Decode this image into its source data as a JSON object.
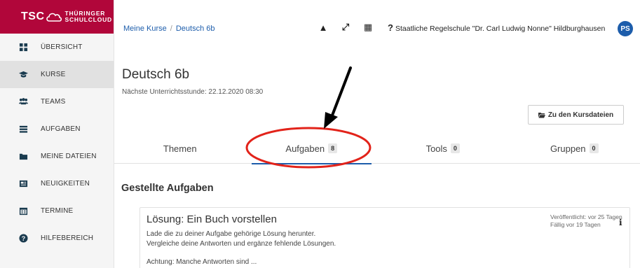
{
  "logo": {
    "abbr": "TSC",
    "line1": "THÜRINGER",
    "line2": "SCHULCLOUD"
  },
  "sidebar": {
    "items": [
      {
        "label": "ÜBERSICHT",
        "icon": "dashboard-icon",
        "active": false
      },
      {
        "label": "KURSE",
        "icon": "graduation-cap-icon",
        "active": true
      },
      {
        "label": "TEAMS",
        "icon": "users-icon",
        "active": false
      },
      {
        "label": "AUFGABEN",
        "icon": "tasks-icon",
        "active": false
      },
      {
        "label": "MEINE DATEIEN",
        "icon": "folder-icon",
        "active": false
      },
      {
        "label": "NEUIGKEITEN",
        "icon": "newspaper-icon",
        "active": false
      },
      {
        "label": "TERMINE",
        "icon": "calendar-icon",
        "active": false
      },
      {
        "label": "HILFEBEREICH",
        "icon": "question-circle-icon",
        "active": false
      }
    ]
  },
  "header": {
    "breadcrumb": [
      "Meine Kurse",
      "Deutsch 6b"
    ],
    "breadcrumb_separator": "/",
    "icons": [
      {
        "name": "warning-icon",
        "glyph": "▲"
      },
      {
        "name": "fullscreen-icon",
        "glyph": "⤢"
      },
      {
        "name": "qr-code-icon",
        "glyph": "▦"
      },
      {
        "name": "help-icon",
        "glyph": "?"
      }
    ],
    "school": "Staatliche Regelschule \"Dr. Carl Ludwig Nonne\" Hildburghausen",
    "avatar_initials": "PS"
  },
  "course": {
    "title": "Deutsch 6b",
    "next_lesson": "Nächste Unterrichtsstunde: 22.12.2020 08:30",
    "files_button": "Zu den Kursdateien"
  },
  "tabs": [
    {
      "label": "Themen",
      "badge": null,
      "active": false
    },
    {
      "label": "Aufgaben",
      "badge": "8",
      "active": true
    },
    {
      "label": "Tools",
      "badge": "0",
      "active": false
    },
    {
      "label": "Gruppen",
      "badge": "0",
      "active": false
    }
  ],
  "section": {
    "title": "Gestellte Aufgaben"
  },
  "task": {
    "title": "Lösung: Ein Buch vorstellen",
    "desc_line1": "Lade die zu deiner Aufgabe gehörige Lösung herunter.",
    "desc_line2": "Vergleiche deine Antworten und ergänze fehlende Lösungen.",
    "desc_line3": "Achtung: Manche Antworten sind ...",
    "published": "Veröffentlicht: vor 25 Tagen",
    "due": "Fällig vor 19 Tagen"
  },
  "colors": {
    "brand": "#b1063a",
    "link": "#1d5dab",
    "annotation": "#e2231a"
  }
}
